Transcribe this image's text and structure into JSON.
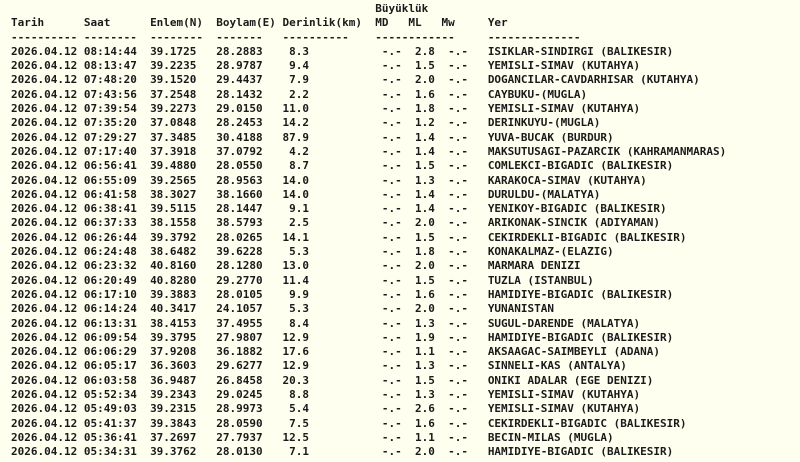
{
  "page": {
    "background_color": "#FFFFF0",
    "text_color": "#1A1A1A"
  },
  "table": {
    "group_header": "Büyüklük",
    "columns": {
      "date": "Tarih",
      "time": "Saat",
      "lat": "Enlem(N)",
      "lon": "Boylam(E)",
      "depth": "Derinlik(km)",
      "md": "MD",
      "ml": "ML",
      "mw": "Mw",
      "place": "Yer"
    },
    "separators": {
      "date": "----------",
      "time": "--------",
      "lat": "--------",
      "lon": "-------",
      "depth": "----------",
      "magnitude": "------------",
      "place": "--------------"
    },
    "rows": [
      {
        "date": "2026.04.12",
        "time": "08:14:44",
        "lat": "39.1725",
        "lon": "28.2883",
        "depth": "8.3",
        "md": "-.-",
        "ml": "2.8",
        "mw": "-.-",
        "place": "ISIKLAR-SINDIRGI (BALIKESIR)"
      },
      {
        "date": "2026.04.12",
        "time": "08:13:47",
        "lat": "39.2235",
        "lon": "28.9787",
        "depth": "9.4",
        "md": "-.-",
        "ml": "1.5",
        "mw": "-.-",
        "place": "YEMISLI-SIMAV (KUTAHYA)"
      },
      {
        "date": "2026.04.12",
        "time": "07:48:20",
        "lat": "39.1520",
        "lon": "29.4437",
        "depth": "7.9",
        "md": "-.-",
        "ml": "2.0",
        "mw": "-.-",
        "place": "DOGANCILAR-CAVDARHISAR (KUTAHYA)"
      },
      {
        "date": "2026.04.12",
        "time": "07:43:56",
        "lat": "37.2548",
        "lon": "28.1432",
        "depth": "2.2",
        "md": "-.-",
        "ml": "1.6",
        "mw": "-.-",
        "place": "CAYBUKU-(MUGLA)"
      },
      {
        "date": "2026.04.12",
        "time": "07:39:54",
        "lat": "39.2273",
        "lon": "29.0150",
        "depth": "11.0",
        "md": "-.-",
        "ml": "1.8",
        "mw": "-.-",
        "place": "YEMISLI-SIMAV (KUTAHYA)"
      },
      {
        "date": "2026.04.12",
        "time": "07:35:20",
        "lat": "37.0848",
        "lon": "28.2453",
        "depth": "14.2",
        "md": "-.-",
        "ml": "1.2",
        "mw": "-.-",
        "place": "DERINKUYU-(MUGLA)"
      },
      {
        "date": "2026.04.12",
        "time": "07:29:27",
        "lat": "37.3485",
        "lon": "30.4188",
        "depth": "87.9",
        "md": "-.-",
        "ml": "1.4",
        "mw": "-.-",
        "place": "YUVA-BUCAK (BURDUR)"
      },
      {
        "date": "2026.04.12",
        "time": "07:17:40",
        "lat": "37.3918",
        "lon": "37.0792",
        "depth": "4.2",
        "md": "-.-",
        "ml": "1.4",
        "mw": "-.-",
        "place": "MAKSUTUSAGI-PAZARCIK (KAHRAMANMARAS)"
      },
      {
        "date": "2026.04.12",
        "time": "06:56:41",
        "lat": "39.4880",
        "lon": "28.0550",
        "depth": "8.7",
        "md": "-.-",
        "ml": "1.5",
        "mw": "-.-",
        "place": "COMLEKCI-BIGADIC (BALIKESIR)"
      },
      {
        "date": "2026.04.12",
        "time": "06:55:09",
        "lat": "39.2565",
        "lon": "28.9563",
        "depth": "14.0",
        "md": "-.-",
        "ml": "1.3",
        "mw": "-.-",
        "place": "KARAKOCA-SIMAV (KUTAHYA)"
      },
      {
        "date": "2026.04.12",
        "time": "06:41:58",
        "lat": "38.3027",
        "lon": "38.1660",
        "depth": "14.0",
        "md": "-.-",
        "ml": "1.4",
        "mw": "-.-",
        "place": "DURULDU-(MALATYA)"
      },
      {
        "date": "2026.04.12",
        "time": "06:38:41",
        "lat": "39.5115",
        "lon": "28.1447",
        "depth": "9.1",
        "md": "-.-",
        "ml": "1.4",
        "mw": "-.-",
        "place": "YENIKOY-BIGADIC (BALIKESIR)"
      },
      {
        "date": "2026.04.12",
        "time": "06:37:33",
        "lat": "38.1558",
        "lon": "38.5793",
        "depth": "2.5",
        "md": "-.-",
        "ml": "2.0",
        "mw": "-.-",
        "place": "ARIKONAK-SINCIK (ADIYAMAN)"
      },
      {
        "date": "2026.04.12",
        "time": "06:26:44",
        "lat": "39.3792",
        "lon": "28.0265",
        "depth": "14.1",
        "md": "-.-",
        "ml": "1.5",
        "mw": "-.-",
        "place": "CEKIRDEKLI-BIGADIC (BALIKESIR)"
      },
      {
        "date": "2026.04.12",
        "time": "06:24:48",
        "lat": "38.6482",
        "lon": "39.6228",
        "depth": "5.3",
        "md": "-.-",
        "ml": "1.8",
        "mw": "-.-",
        "place": "KONAKALMAZ-(ELAZIG)"
      },
      {
        "date": "2026.04.12",
        "time": "06:23:32",
        "lat": "40.8160",
        "lon": "28.1280",
        "depth": "13.0",
        "md": "-.-",
        "ml": "2.0",
        "mw": "-.-",
        "place": "MARMARA DENIZI"
      },
      {
        "date": "2026.04.12",
        "time": "06:20:49",
        "lat": "40.8280",
        "lon": "29.2770",
        "depth": "11.4",
        "md": "-.-",
        "ml": "1.5",
        "mw": "-.-",
        "place": "TUZLA (ISTANBUL)"
      },
      {
        "date": "2026.04.12",
        "time": "06:17:10",
        "lat": "39.3883",
        "lon": "28.0105",
        "depth": "9.9",
        "md": "-.-",
        "ml": "1.6",
        "mw": "-.-",
        "place": "HAMIDIYE-BIGADIC (BALIKESIR)"
      },
      {
        "date": "2026.04.12",
        "time": "06:14:24",
        "lat": "40.3417",
        "lon": "24.1057",
        "depth": "5.3",
        "md": "-.-",
        "ml": "2.0",
        "mw": "-.-",
        "place": "YUNANISTAN"
      },
      {
        "date": "2026.04.12",
        "time": "06:13:31",
        "lat": "38.4153",
        "lon": "37.4955",
        "depth": "8.4",
        "md": "-.-",
        "ml": "1.3",
        "mw": "-.-",
        "place": "SUGUL-DARENDE (MALATYA)"
      },
      {
        "date": "2026.04.12",
        "time": "06:09:54",
        "lat": "39.3795",
        "lon": "27.9807",
        "depth": "12.9",
        "md": "-.-",
        "ml": "1.9",
        "mw": "-.-",
        "place": "HAMIDIYE-BIGADIC (BALIKESIR)"
      },
      {
        "date": "2026.04.12",
        "time": "06:06:29",
        "lat": "37.9208",
        "lon": "36.1882",
        "depth": "17.6",
        "md": "-.-",
        "ml": "1.1",
        "mw": "-.-",
        "place": "AKSAAGAC-SAIMBEYLI (ADANA)"
      },
      {
        "date": "2026.04.12",
        "time": "06:05:17",
        "lat": "36.3603",
        "lon": "29.6277",
        "depth": "12.9",
        "md": "-.-",
        "ml": "1.3",
        "mw": "-.-",
        "place": "SINNELI-KAS (ANTALYA)"
      },
      {
        "date": "2026.04.12",
        "time": "06:03:58",
        "lat": "36.9487",
        "lon": "26.8458",
        "depth": "20.3",
        "md": "-.-",
        "ml": "1.5",
        "mw": "-.-",
        "place": "ONIKI ADALAR (EGE DENIZI)"
      },
      {
        "date": "2026.04.12",
        "time": "05:52:34",
        "lat": "39.2343",
        "lon": "29.0245",
        "depth": "8.8",
        "md": "-.-",
        "ml": "1.3",
        "mw": "-.-",
        "place": "YEMISLI-SIMAV (KUTAHYA)"
      },
      {
        "date": "2026.04.12",
        "time": "05:49:03",
        "lat": "39.2315",
        "lon": "28.9973",
        "depth": "5.4",
        "md": "-.-",
        "ml": "2.6",
        "mw": "-.-",
        "place": "YEMISLI-SIMAV (KUTAHYA)"
      },
      {
        "date": "2026.04.12",
        "time": "05:41:37",
        "lat": "39.3843",
        "lon": "28.0590",
        "depth": "7.5",
        "md": "-.-",
        "ml": "1.6",
        "mw": "-.-",
        "place": "CEKIRDEKLI-BIGADIC (BALIKESIR)"
      },
      {
        "date": "2026.04.12",
        "time": "05:36:41",
        "lat": "37.2697",
        "lon": "27.7937",
        "depth": "12.5",
        "md": "-.-",
        "ml": "1.1",
        "mw": "-.-",
        "place": "BECIN-MILAS (MUGLA)"
      },
      {
        "date": "2026.04.12",
        "time": "05:34:31",
        "lat": "39.3762",
        "lon": "28.0130",
        "depth": "7.1",
        "md": "-.-",
        "ml": "2.0",
        "mw": "-.-",
        "place": "HAMIDIYE-BIGADIC (BALIKESIR)"
      }
    ]
  }
}
